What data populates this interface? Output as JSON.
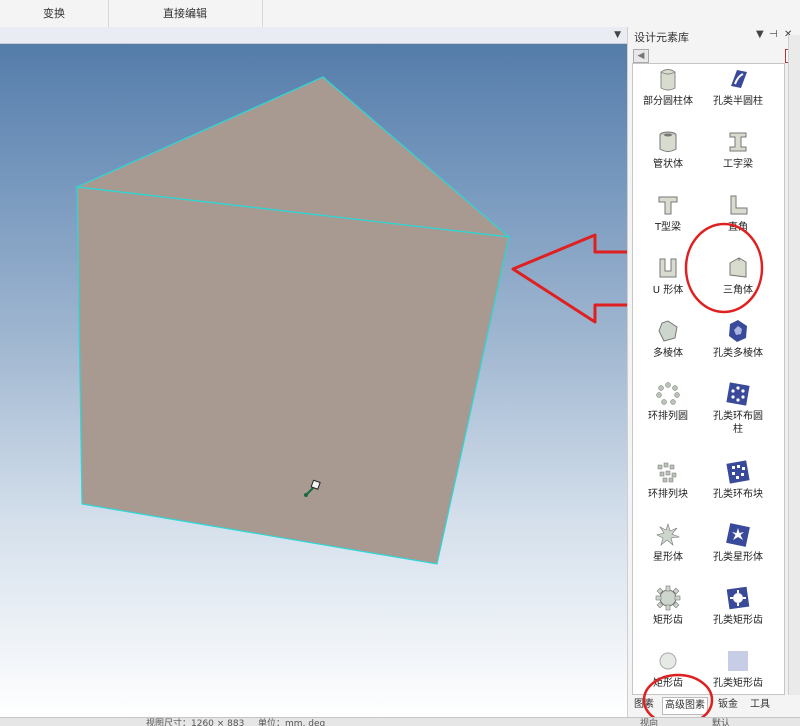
{
  "toolbar": {
    "tabs": [
      {
        "label": "变换"
      },
      {
        "label": "直接编辑"
      }
    ]
  },
  "panel": {
    "title": "设计元素库",
    "pin_icon": "pin-icon",
    "close_icon": "close-icon",
    "items": [
      {
        "label": "部分圆柱体",
        "icon": "partial-cylinder-icon"
      },
      {
        "label": "孔类半圆柱",
        "icon": "hole-half-cylinder-icon"
      },
      {
        "label": "管状体",
        "icon": "tube-icon"
      },
      {
        "label": "工字梁",
        "icon": "i-beam-icon"
      },
      {
        "label": "T型梁",
        "icon": "t-beam-icon"
      },
      {
        "label": "直角",
        "icon": "right-angle-icon"
      },
      {
        "label": "U 形体",
        "icon": "u-shape-icon"
      },
      {
        "label": "三角体",
        "icon": "triangle-prism-icon"
      },
      {
        "label": "多棱体",
        "icon": "polyhedron-icon"
      },
      {
        "label": "孔类多棱体",
        "icon": "hole-polyhedron-icon"
      },
      {
        "label": "环排列圆",
        "icon": "ring-array-circle-icon"
      },
      {
        "label": "孔类环布圆柱",
        "icon": "hole-ring-cylinder-icon"
      },
      {
        "label": "环排列块",
        "icon": "ring-array-block-icon"
      },
      {
        "label": "孔类环布块",
        "icon": "hole-ring-block-icon"
      },
      {
        "label": "星形体",
        "icon": "star-shape-icon"
      },
      {
        "label": "孔类星形体",
        "icon": "hole-star-icon"
      },
      {
        "label": "矩形齿",
        "icon": "rect-gear-icon"
      },
      {
        "label": "孔类矩形齿",
        "icon": "hole-rect-gear-icon"
      },
      {
        "label": "矩形齿",
        "icon": "rect-gear-icon"
      },
      {
        "label": "孔类矩形齿",
        "icon": "hole-rect-gear-icon"
      }
    ],
    "bottom_tabs": [
      {
        "label": "图素"
      },
      {
        "label": "高级图素"
      },
      {
        "label": "钣金"
      },
      {
        "label": "工具"
      }
    ]
  },
  "status": {
    "view_size": "视图尺寸：1260 × 883",
    "unit": "单位：mm, deg",
    "scale": "视向",
    "extra": "默认"
  },
  "colors": {
    "prism_face": "#a89a90",
    "edge_highlight": "#2ad8d8",
    "annotation_red": "#e02020",
    "icon_gray": "#c8d0c8",
    "icon_blue": "#3a4a9a"
  }
}
